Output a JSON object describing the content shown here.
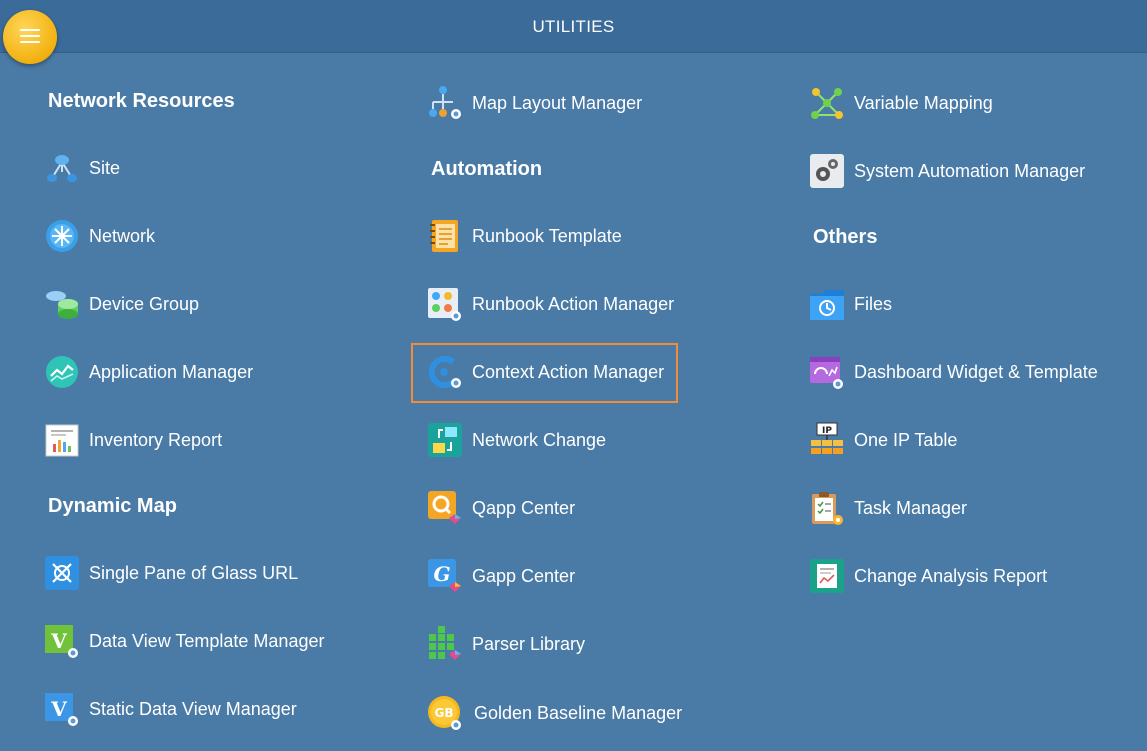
{
  "header": {
    "title": "UTILITIES"
  },
  "columns": {
    "col1": {
      "network_resources": {
        "title": "Network Resources",
        "items": [
          "Site",
          "Network",
          "Device Group",
          "Application Manager",
          "Inventory Report"
        ]
      },
      "dynamic_map": {
        "title": "Dynamic Map",
        "items": [
          "Single Pane of Glass URL",
          "Data View Template Manager",
          "Static Data View Manager"
        ]
      }
    },
    "col2": {
      "top_item": "Map Layout Manager",
      "automation": {
        "title": "Automation",
        "items": [
          "Runbook Template",
          "Runbook Action Manager",
          "Context Action Manager",
          "Network Change",
          "Qapp Center",
          "Gapp Center",
          "Parser Library",
          "Golden Baseline Manager"
        ]
      }
    },
    "col3": {
      "top_items": [
        "Variable Mapping",
        "System Automation Manager"
      ],
      "others": {
        "title": "Others",
        "items": [
          "Files",
          "Dashboard Widget & Template",
          "One IP Table",
          "Task Manager",
          "Change Analysis Report"
        ]
      }
    }
  },
  "icon_text": {
    "ip": "IP",
    "gb": "GB",
    "v": "V",
    "g": "G"
  },
  "colors": {
    "background": "#4a7ba6",
    "header": "#3a6b99",
    "menu_button": "#f2b10e",
    "highlight": "#f08c3a"
  }
}
